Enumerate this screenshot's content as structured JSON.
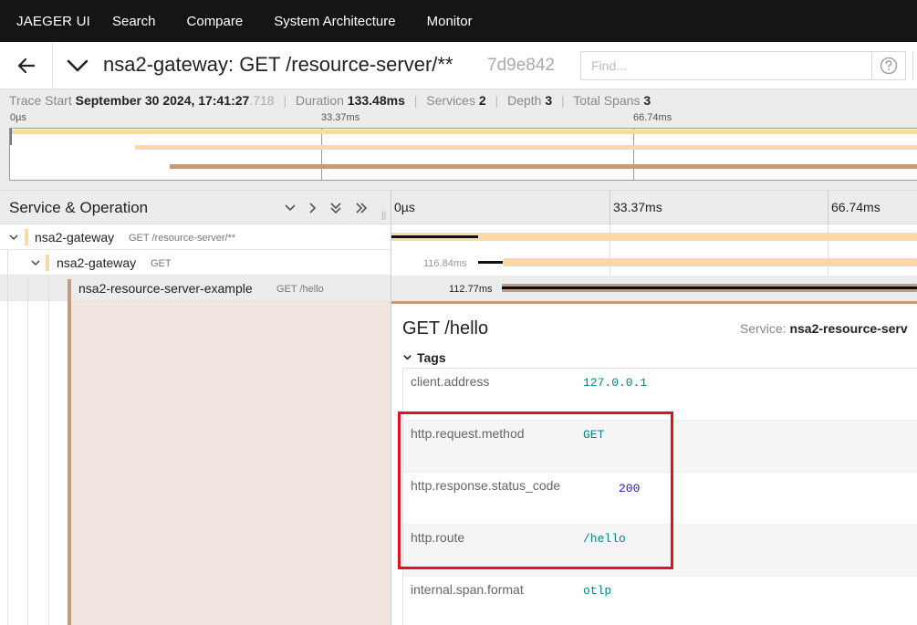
{
  "topnav": {
    "brand": "JAEGER UI",
    "items": [
      "Search",
      "Compare",
      "System Architecture",
      "Monitor"
    ]
  },
  "trace_header": {
    "back_icon": "arrow-left-icon",
    "collapse_icon": "chevron-down-icon",
    "title": "nsa2-gateway: GET /resource-server/**",
    "trace_id": "7d9e842",
    "find_placeholder": "Find...",
    "help_icon": "question-circle-icon"
  },
  "overview": {
    "trace_start_label": "Trace Start",
    "trace_start_value": "September 30 2024, 17:41:27",
    "trace_start_ms": ".718",
    "duration_label": "Duration",
    "duration_value": "133.48ms",
    "services_label": "Services",
    "services_value": "2",
    "depth_label": "Depth",
    "depth_value": "3",
    "total_spans_label": "Total Spans",
    "total_spans_value": "3",
    "ticks": [
      "0µs",
      "33.37ms",
      "66.74ms"
    ]
  },
  "tree_header": {
    "title": "Service & Operation",
    "ticks": [
      "0µs",
      "33.37ms",
      "66.74ms"
    ]
  },
  "spans": [
    {
      "service": "nsa2-gateway",
      "operation": "GET /resource-server/**",
      "color": "#fbd9a4",
      "duration_label": ""
    },
    {
      "service": "nsa2-gateway",
      "operation": "GET",
      "color": "#fbd9a4",
      "duration_label": "116.84ms"
    },
    {
      "service": "nsa2-resource-server-example",
      "operation": "GET /hello",
      "color": "#c49a7c",
      "duration_label": "112.77ms"
    }
  ],
  "detail": {
    "title": "GET /hello",
    "service_label": "Service:",
    "service_value": "nsa2-resource-serv",
    "tags_label": "Tags",
    "tags": [
      {
        "key": "client.address",
        "value": "127.0.0.1"
      },
      {
        "key": "http.request.method",
        "value": "GET"
      },
      {
        "key": "http.response.status_code",
        "value": "200"
      },
      {
        "key": "http.route",
        "value": "/hello"
      },
      {
        "key": "internal.span.format",
        "value": "otlp"
      }
    ]
  },
  "colors": {
    "gateway": "#fbd9a4",
    "resource_server": "#c49a7c",
    "highlight": "#e0121d"
  }
}
